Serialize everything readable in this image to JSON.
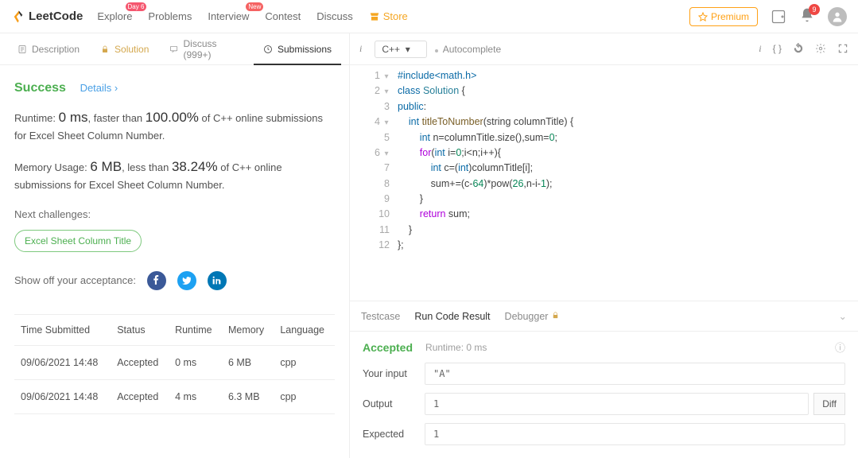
{
  "nav": {
    "logo": "LeetCode",
    "links": {
      "explore": "Explore",
      "explore_badge": "Day 6",
      "problems": "Problems",
      "interview": "Interview",
      "interview_badge": "New",
      "contest": "Contest",
      "discuss": "Discuss",
      "store": "Store"
    },
    "premium": "Premium",
    "bell_count": "9"
  },
  "left_tabs": {
    "description": "Description",
    "solution": "Solution",
    "discuss": "Discuss (999+)",
    "submissions": "Submissions"
  },
  "result": {
    "success": "Success",
    "details": "Details",
    "runtime_label": "Runtime:",
    "runtime_value": "0 ms",
    "runtime_suffix": ", faster than",
    "runtime_pct": "100.00%",
    "runtime_tail": "of C++ online submissions for Excel Sheet Column Number.",
    "memory_label": "Memory Usage:",
    "memory_value": "6 MB",
    "memory_suffix": ", less than",
    "memory_pct": "38.24%",
    "memory_tail": "of C++ online submissions for Excel Sheet Column Number.",
    "next_label": "Next challenges:",
    "next_chip": "Excel Sheet Column Title",
    "show_off": "Show off your acceptance:"
  },
  "sub_table": {
    "headers": {
      "time": "Time Submitted",
      "status": "Status",
      "runtime": "Runtime",
      "memory": "Memory",
      "lang": "Language"
    },
    "rows": [
      {
        "time": "09/06/2021 14:48",
        "status": "Accepted",
        "runtime": "0 ms",
        "memory": "6 MB",
        "lang": "cpp"
      },
      {
        "time": "09/06/2021 14:48",
        "status": "Accepted",
        "runtime": "4 ms",
        "memory": "6.3 MB",
        "lang": "cpp"
      }
    ]
  },
  "editor": {
    "language": "C++",
    "autocomplete": "Autocomplete"
  },
  "code_lines": [
    "#include<math.h>",
    "class Solution {",
    "public:",
    "    int titleToNumber(string columnTitle) {",
    "        int n=columnTitle.size(),sum=0;",
    "        for(int i=0;i<n;i++){",
    "            int c=(int)columnTitle[i];",
    "            sum+=(c-64)*pow(26,n-i-1);",
    "        }",
    "        return sum;",
    "    }",
    "};"
  ],
  "result_panel": {
    "tab_testcase": "Testcase",
    "tab_run": "Run Code Result",
    "tab_debug": "Debugger",
    "status": "Accepted",
    "runtime": "Runtime: 0 ms",
    "input_label": "Your input",
    "input_value": "\"A\"",
    "output_label": "Output",
    "output_value": "1",
    "expected_label": "Expected",
    "expected_value": "1",
    "diff": "Diff"
  }
}
